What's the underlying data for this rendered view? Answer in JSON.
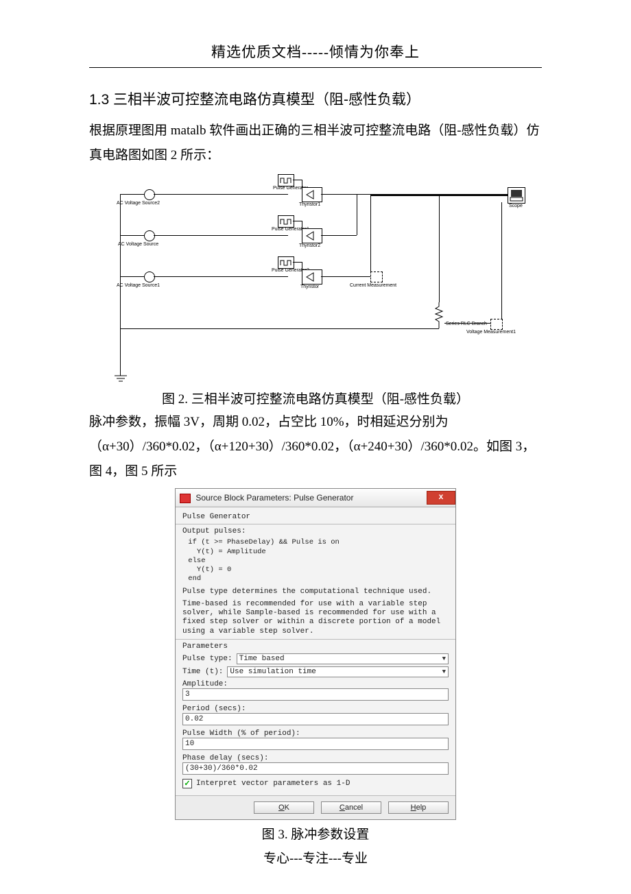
{
  "header": "精选优质文档-----倾情为你奉上",
  "section_title": "1.3 三相半波可控整流电路仿真模型（阻-感性负载）",
  "intro": "根据原理图用 matalb 软件画出正确的三相半波可控整流电路（阻-感性负载）仿真电路图如图 2 所示：",
  "fig2_caption": "图 2. 三相半波可控整流电路仿真模型（阻-感性负载）",
  "pulse_text_1": "脉冲参数，振幅 3V，周期 0.02，占空比 10%，时相延迟分别为（α+30）/360*0.02，（α+120+30）/360*0.02，（α+240+30）/360*0.02。如图 3，图 4，图 5 所示",
  "fig3_caption": "图 3. 脉冲参数设置",
  "footer": "专心---专注---专业",
  "sim": {
    "ac_source2": "AC Voltage Source2",
    "ac_source": "AC Voltage Source",
    "ac_source1": "AC Voltage Source1",
    "pulse_gen": "Pulse\nGenerator",
    "pulse_gen1": "Pulse\nGenerator1",
    "pulse_gen2": "Pulse\nGenerator2",
    "thyristor1": "Thyristor1",
    "thyristor2": "Thyristor2",
    "thyristor": "Thyristor",
    "current_meas": "Current Measurement",
    "rlc_branch": "Series RLC Branch",
    "volt_meas": "Voltage Measurement1",
    "scope": "Scope"
  },
  "dialog": {
    "title": "Source Block Parameters: Pulse Generator",
    "heading": "Pulse Generator",
    "output_pulses": "Output pulses:",
    "code": " if (t >= PhaseDelay) && Pulse is on\n   Y(t) = Amplitude\n else\n   Y(t) = 0\n end",
    "desc1": "Pulse type determines the computational technique used.",
    "desc2": "Time-based is recommended for use with a variable step solver, while Sample-based is recommended for use with a fixed step solver or within a discrete portion of a model using a variable step solver.",
    "params_heading": "Parameters",
    "pulse_type_label": "Pulse type:",
    "pulse_type_value": "Time based",
    "time_t_label": "Time (t):",
    "time_t_value": "Use simulation time",
    "amplitude_label": "Amplitude:",
    "amplitude_value": "3",
    "period_label": "Period (secs):",
    "period_value": "0.02",
    "width_label": "Pulse Width (% of period):",
    "width_value": "10",
    "delay_label": "Phase delay (secs):",
    "delay_value": "(30+30)/360*0.02",
    "interpret_label": "Interpret vector parameters as 1-D",
    "ok": "OK",
    "cancel": "Cancel",
    "help": "Help"
  }
}
